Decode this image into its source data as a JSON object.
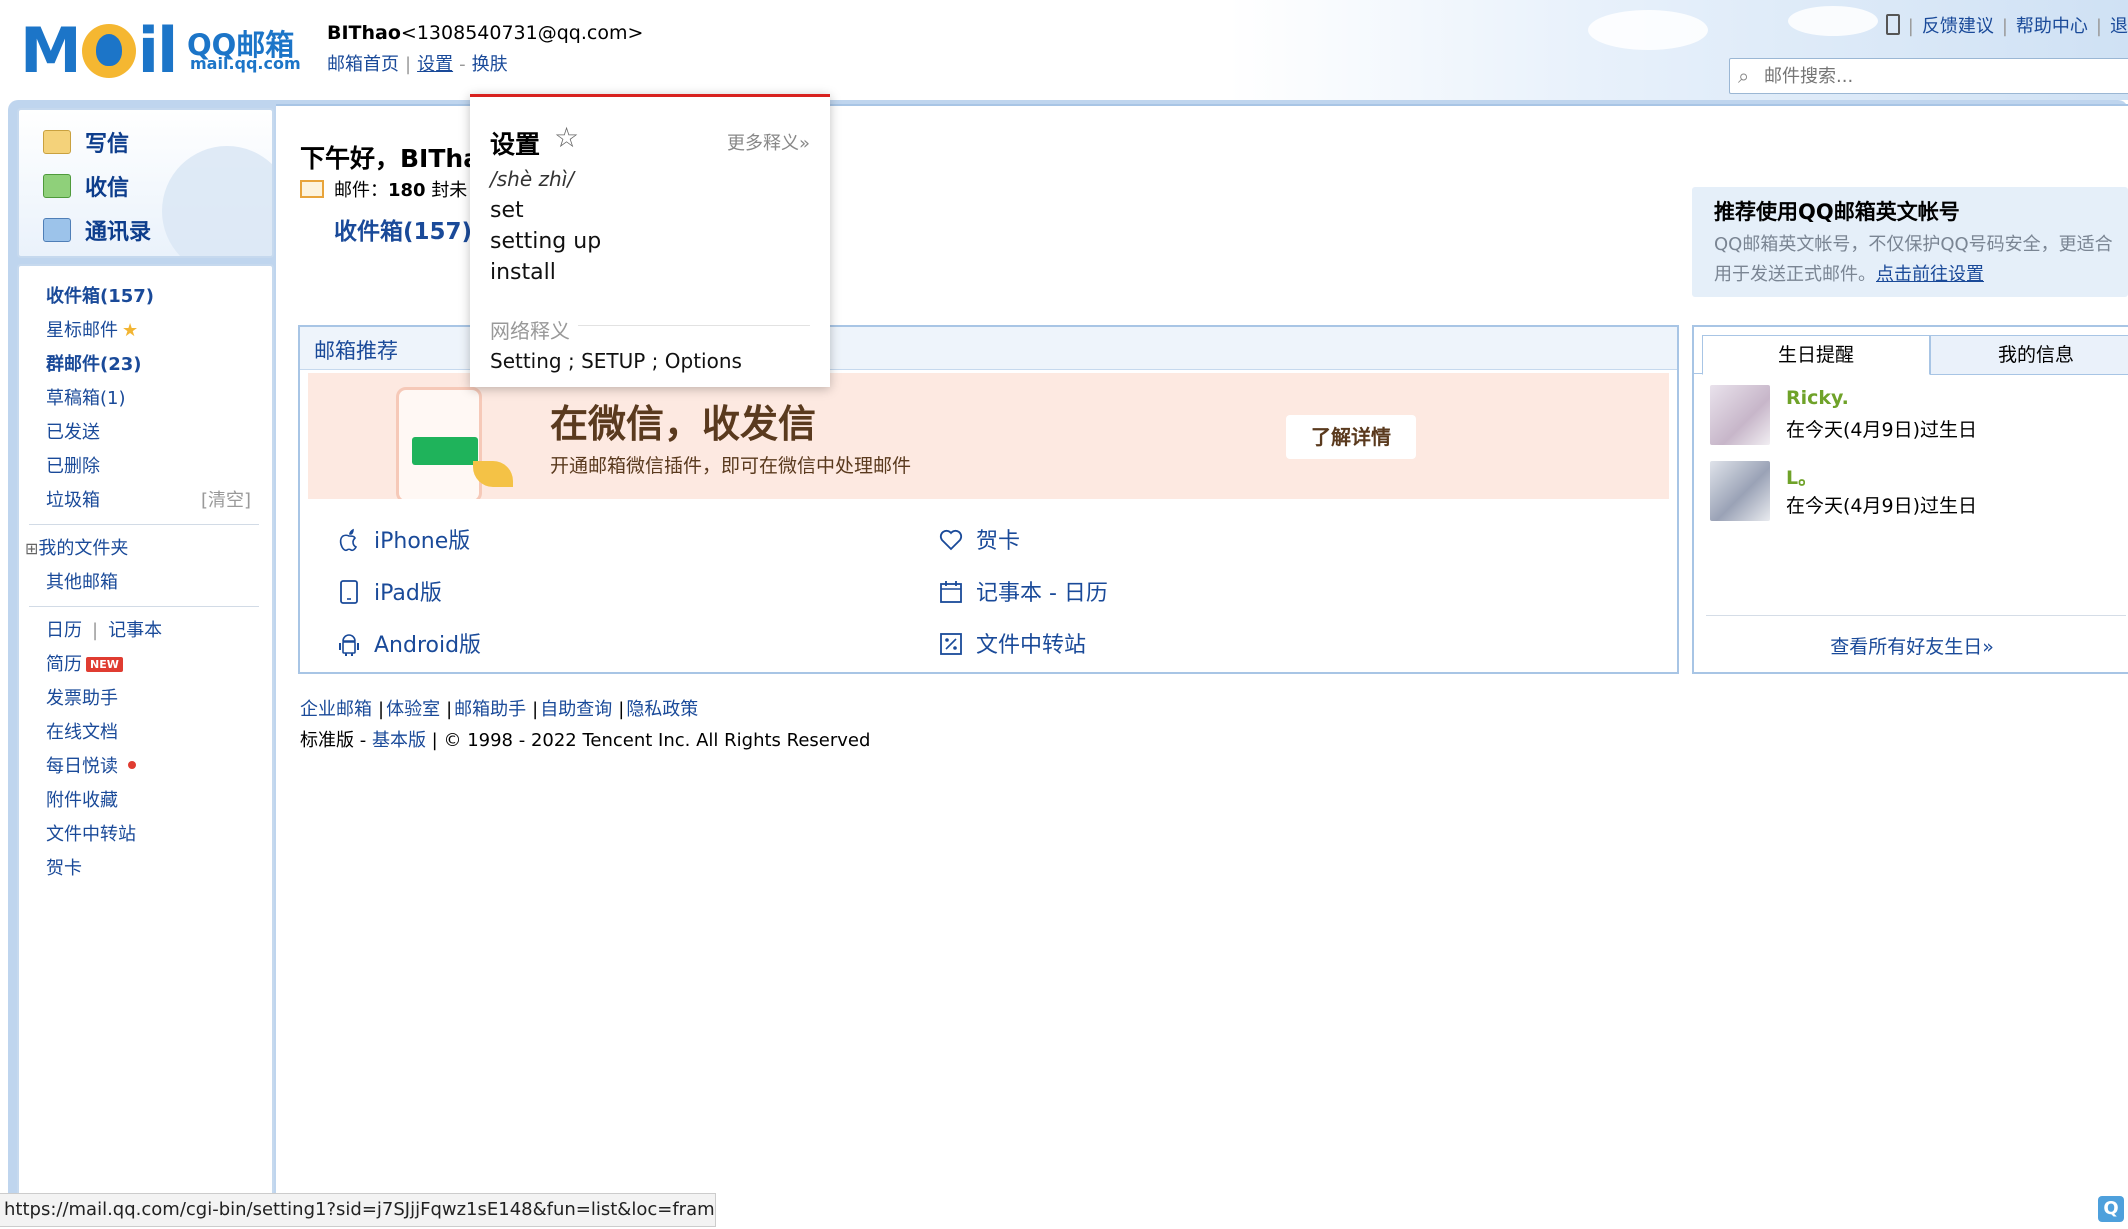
{
  "header": {
    "logo_mail": "M",
    "logo_mail_tail": "il",
    "logo_qq": "QQ邮箱",
    "logo_url": "mail.qq.com",
    "user_name": "BIThao",
    "user_email": "<1308540731@qq.com>",
    "nav": [
      "邮箱首页",
      "设置",
      "换肤"
    ],
    "top_links": [
      "反馈建议",
      "帮助中心",
      "退"
    ],
    "search_placeholder": "邮件搜索..."
  },
  "sidebar": {
    "commands": [
      "写信",
      "收信",
      "通讯录"
    ],
    "folders": {
      "inbox": "收件箱(157)",
      "starred": "星标邮件",
      "group": "群邮件(23)",
      "drafts": "草稿箱(1)",
      "sent": "已发送",
      "deleted": "已删除",
      "trash": "垃圾箱",
      "trash_clear": "[清空]",
      "my_folders_toggle": "⊞",
      "my_folders": "我的文件夹",
      "other_mail": "其他邮箱"
    },
    "tools": {
      "calendar": "日历",
      "notes": "记事本",
      "resume": "简历",
      "new_badge": "NEW",
      "invoice": "发票助手",
      "docs": "在线文档",
      "daily": "每日悦读",
      "attachments": "附件收藏",
      "transfer": "文件中转站",
      "cards": "贺卡"
    }
  },
  "main": {
    "greeting": "下午好，BITha",
    "mail_count_label": "邮件：",
    "mail_count_value": "180",
    "mail_count_suffix": "封未",
    "inbox_link": "收件箱(157)",
    "recommend": {
      "title": "邮箱推荐",
      "banner_title": "在微信，收发信",
      "banner_sub": "开通邮箱微信插件，即可在微信中处理邮件",
      "banner_button": "了解详情",
      "items": {
        "iphone": "iPhone版",
        "ipad": "iPad版",
        "android": "Android版",
        "cards": "贺卡",
        "notes": "记事本 - 日历",
        "transfer": "文件中转站"
      }
    },
    "footer": {
      "links": [
        "企业邮箱",
        "体验室",
        "邮箱助手",
        "自助查询",
        "隐私政策"
      ],
      "version_current": "标准版",
      "version_link": "基本版",
      "copyright": "© 1998 - 2022 Tencent Inc. All Rights Reserved"
    }
  },
  "right": {
    "promo_title": "推荐使用QQ邮箱英文帐号",
    "promo_desc": "QQ邮箱英文帐号，不仅保护QQ号码安全，更适合用于发送正式邮件。",
    "promo_link": "点击前往设置",
    "tabs": [
      "生日提醒",
      "我的信息"
    ],
    "friends": [
      {
        "name": "Ricky.",
        "note": "在今天(4月9日)过生日"
      },
      {
        "name": "L。",
        "note": "在今天(4月9日)过生日"
      }
    ],
    "view_all": "查看所有好友生日»"
  },
  "dictionary": {
    "word": "设置",
    "star": "☆",
    "more": "更多释义»",
    "pinyin": "/shè zhì/",
    "defs": [
      "set",
      "setting up",
      "install"
    ],
    "web_title": "网络释义",
    "web_defs": "Setting ; SETUP ; Options"
  },
  "status_url": "https://mail.qq.com/cgi-bin/setting1?sid=j7SJjjFqwz1sE148&fun=list&loc=fram...",
  "colors": {
    "link": "#1a4a99",
    "frame": "#bfd5ee",
    "banner_bg": "#fde9e1",
    "friend_name": "#6fa229",
    "dict_accent": "#d8221f"
  }
}
